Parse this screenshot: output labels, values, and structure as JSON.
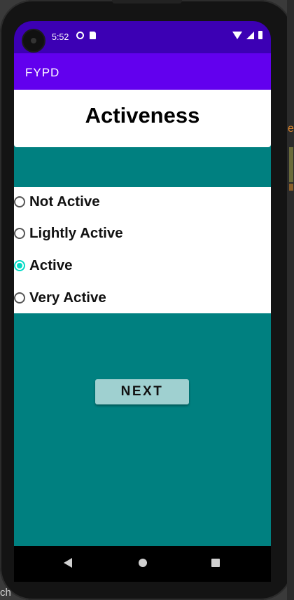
{
  "status_bar": {
    "time": "5:52",
    "icons_left": [
      "data-saver-icon",
      "sd-card-icon"
    ],
    "icons_right": [
      "wifi-icon",
      "signal-icon",
      "battery-icon"
    ]
  },
  "app_bar": {
    "title": "FYPD",
    "color": "#6200ee"
  },
  "page": {
    "title": "Activeness",
    "background": "#008080"
  },
  "activity_options": [
    {
      "label": "Not Active",
      "selected": false
    },
    {
      "label": "Lightly Active",
      "selected": false
    },
    {
      "label": "Active",
      "selected": true
    },
    {
      "label": "Very Active",
      "selected": false
    }
  ],
  "next_button": {
    "label": "NEXT"
  },
  "nav_bar": {
    "icons": [
      "back-icon",
      "home-icon",
      "recents-icon"
    ]
  },
  "side_panel": {
    "visible_text": "e",
    "bottom_text": "ch"
  },
  "colors": {
    "status_bar": "#3c00b4",
    "radio_accent": "#03dac5",
    "button": "#9fd0d0"
  }
}
